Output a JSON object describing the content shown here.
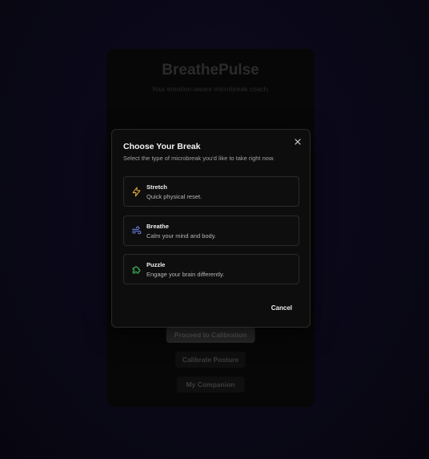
{
  "background": {
    "app_title": "BreathePulse",
    "app_subtitle": "Your emotion-aware microbreak coach.",
    "buttons": {
      "proceed": "Proceed to Calibration",
      "calibrate": "Calibrate Posture",
      "companion": "My Companion"
    }
  },
  "modal": {
    "title": "Choose Your Break",
    "description": "Select the type of microbreak you'd like to take right now.",
    "close_icon": "close-icon",
    "options": [
      {
        "name": "Stretch",
        "description": "Quick physical reset.",
        "icon": "lightning-icon",
        "color": "#e0a83a"
      },
      {
        "name": "Breathe",
        "description": "Calm your mind and body.",
        "icon": "wind-icon",
        "color": "#6a7fe6"
      },
      {
        "name": "Puzzle",
        "description": "Engage your brain differently.",
        "icon": "puzzle-icon",
        "color": "#3fbf5f"
      }
    ],
    "cancel_label": "Cancel"
  },
  "colors": {
    "page_background": "#0c0a18",
    "modal_background": "#0d0d0d",
    "border": "#2a2a2a"
  }
}
